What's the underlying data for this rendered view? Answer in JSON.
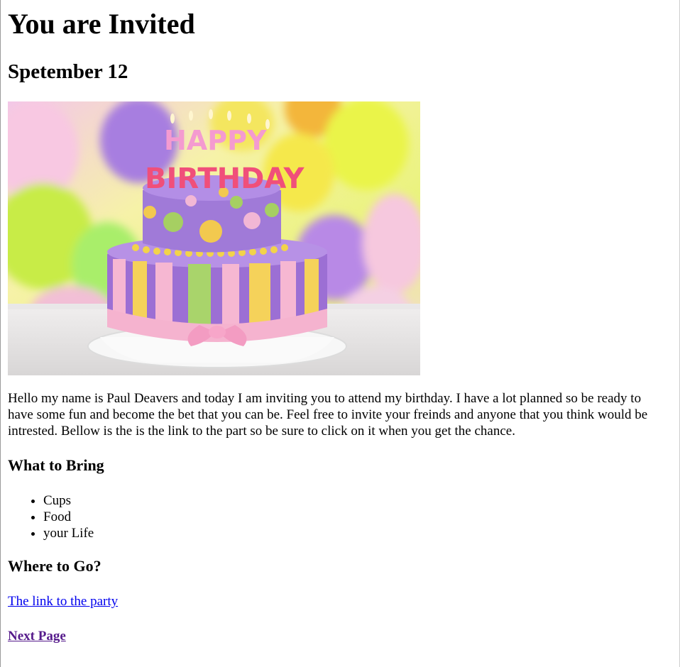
{
  "header": {
    "title": "You are Invited",
    "date": "Spetember 12"
  },
  "photo": {
    "description_icon": "birthday-cake-photo",
    "candle_text_top": "HAPPY",
    "candle_text_bottom": "BIRTHDAY"
  },
  "intro": {
    "text": "Hello my name is Paul Deavers and today I am inviting you to attend my birthday. I have a lot planned so be ready to have some fun and become the bet that you can be. Feel free to invite your freinds and anyone that you think would be intrested. Bellow is the is the link to the part so be sure to click on it when you get the chance."
  },
  "bring": {
    "heading": "What to Bring",
    "items": [
      "Cups",
      "Food",
      "your Life"
    ]
  },
  "location": {
    "heading": "Where to Go?",
    "link_text": "The link to the party"
  },
  "navigation": {
    "next_label": "Next Page"
  },
  "colors": {
    "link": "#0000ee",
    "visited_link": "#551a8b"
  }
}
